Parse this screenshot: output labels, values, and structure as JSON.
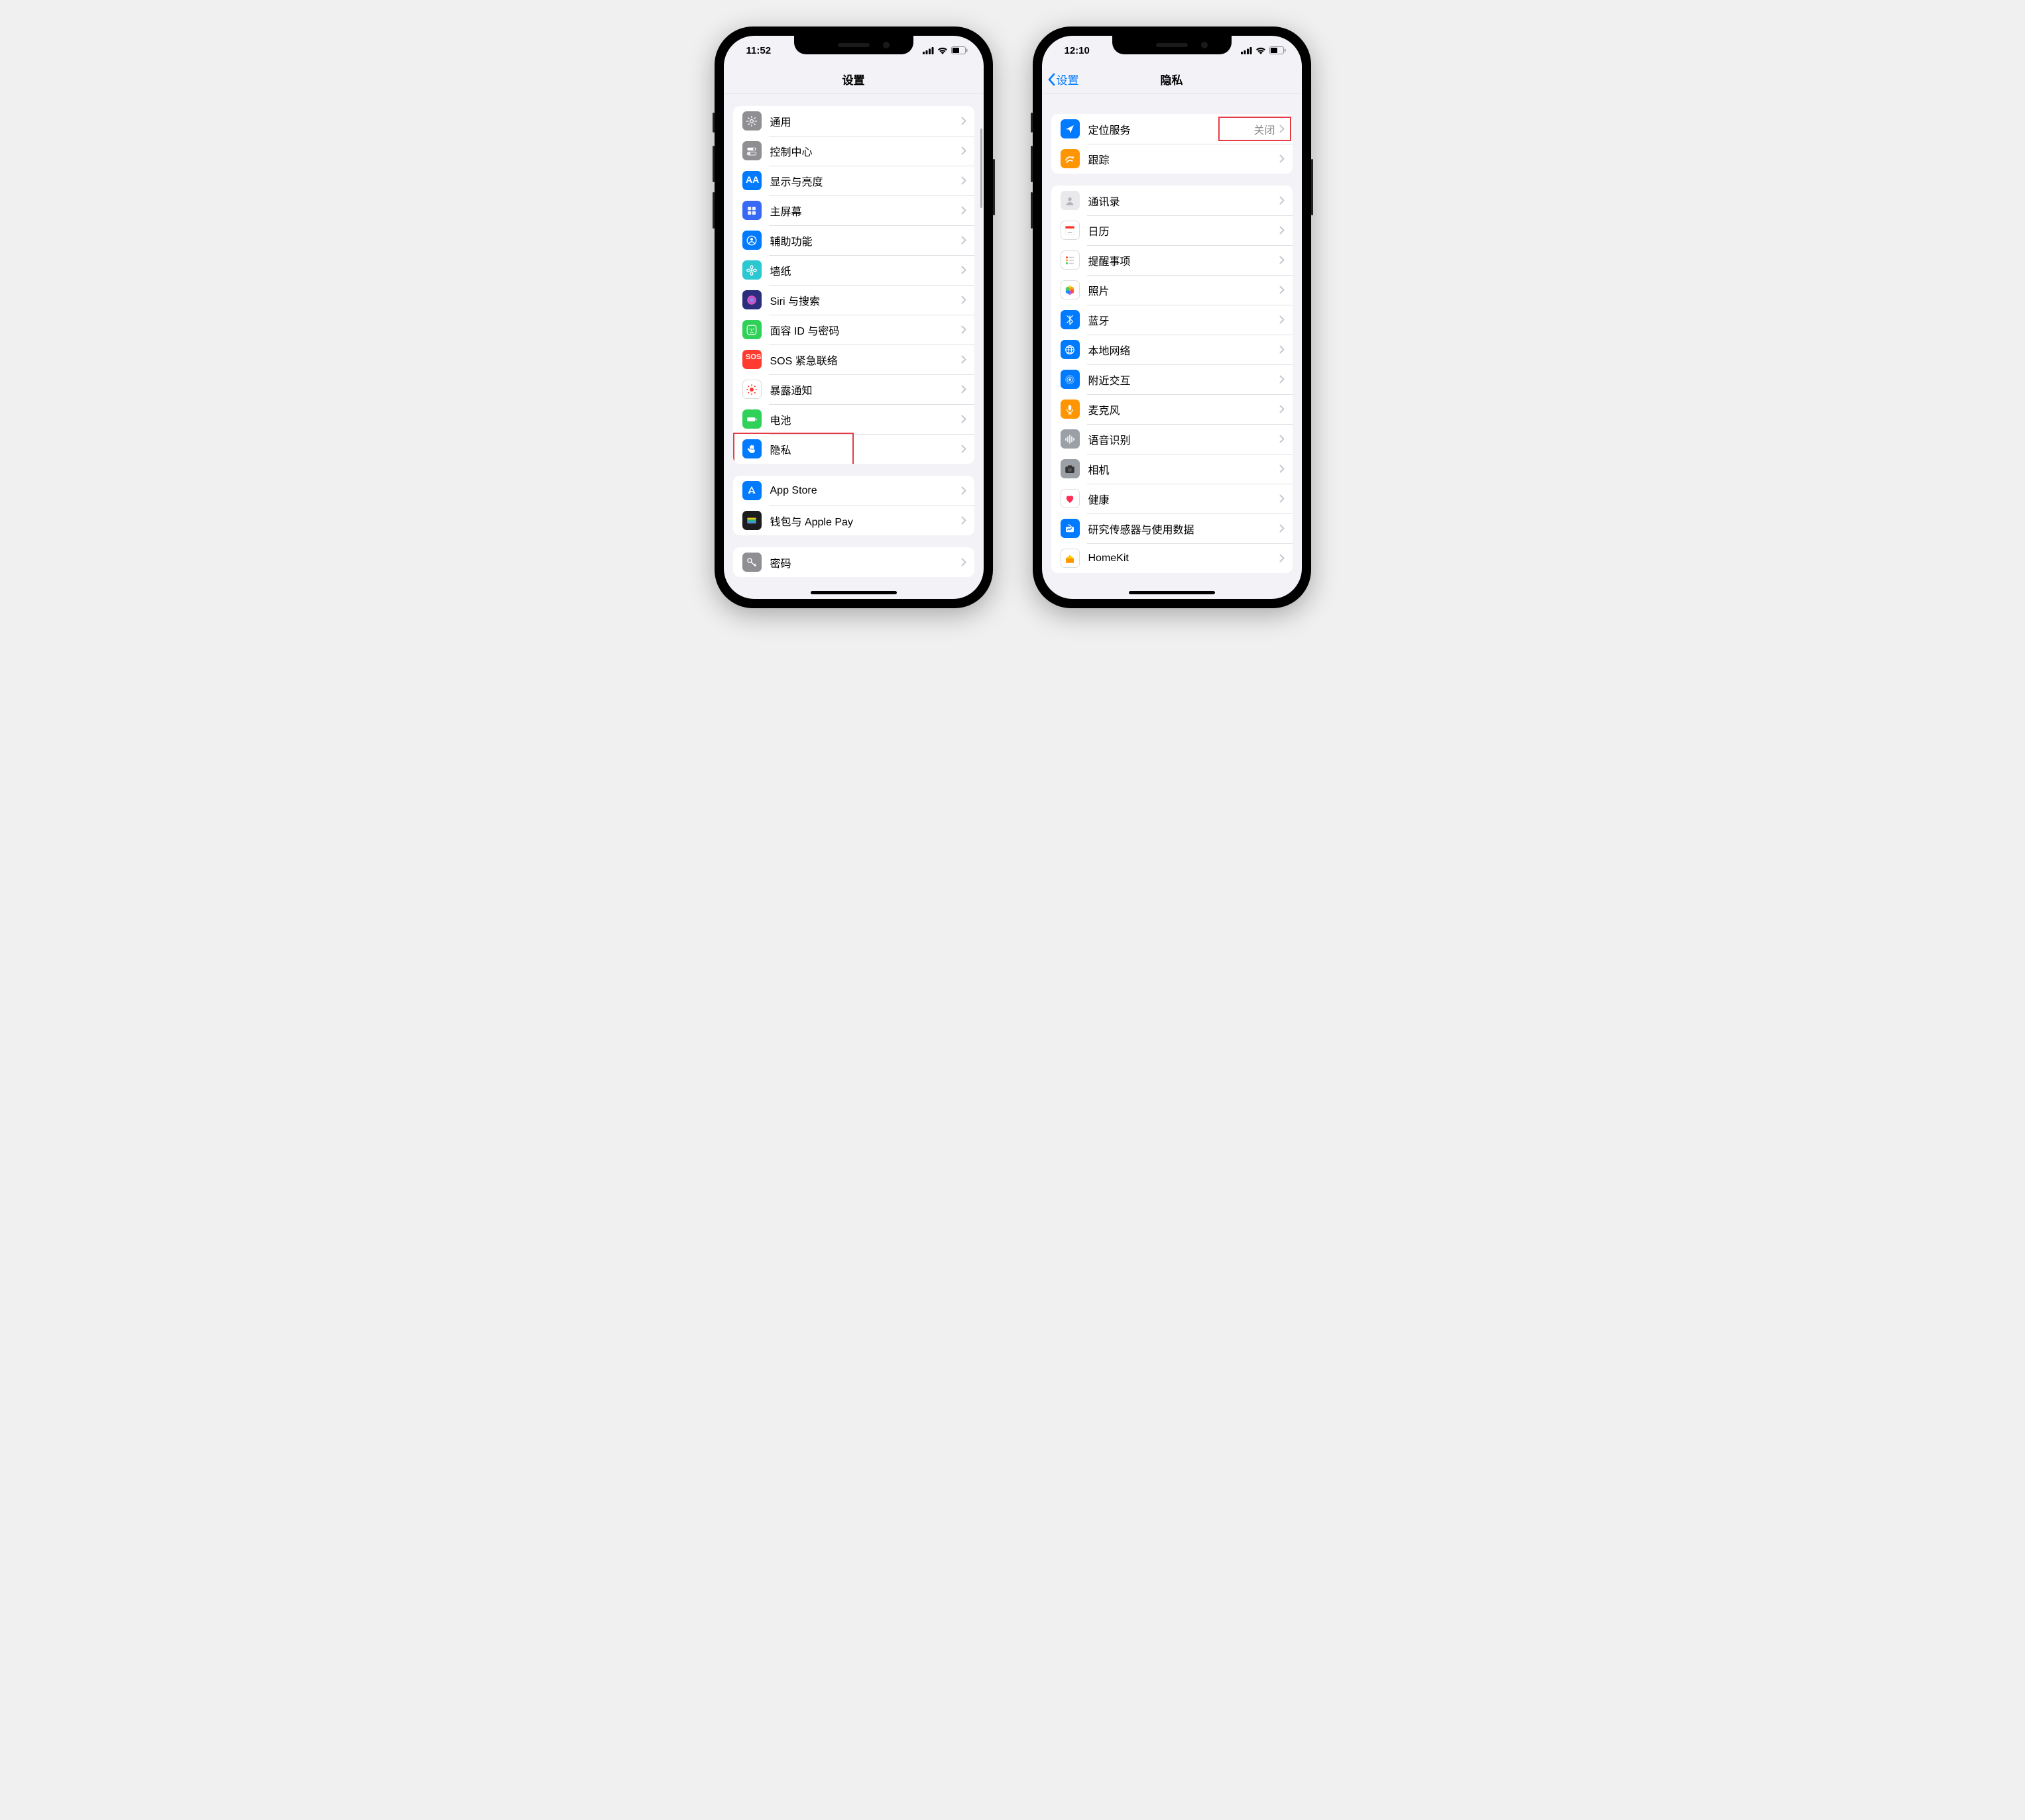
{
  "phones": {
    "left": {
      "statusbar": {
        "time": "11:52"
      },
      "navbar": {
        "title": "设置"
      },
      "groups": [
        {
          "rows": [
            {
              "id": "general",
              "label": "通用",
              "icon_bg": "bg-gray",
              "icon": "gear"
            },
            {
              "id": "control-center",
              "label": "控制中心",
              "icon_bg": "bg-gray",
              "icon": "toggles"
            },
            {
              "id": "display",
              "label": "显示与亮度",
              "icon_bg": "bg-blue",
              "icon": "aa"
            },
            {
              "id": "home-screen",
              "label": "主屏幕",
              "icon_bg": "bg-indigo",
              "icon": "grid"
            },
            {
              "id": "accessibility",
              "label": "辅助功能",
              "icon_bg": "bg-blue",
              "icon": "person"
            },
            {
              "id": "wallpaper",
              "label": "墙纸",
              "icon_bg": "bg-cyan",
              "icon": "flower"
            },
            {
              "id": "siri",
              "label": "Siri 与搜索",
              "icon_bg": "bg-darkblue",
              "icon": "siri"
            },
            {
              "id": "faceid",
              "label": "面容 ID 与密码",
              "icon_bg": "bg-green",
              "icon": "faceid"
            },
            {
              "id": "sos",
              "label": "SOS 紧急联络",
              "icon_bg": "bg-red",
              "icon": "sos"
            },
            {
              "id": "exposure",
              "label": "暴露通知",
              "icon_bg": "bg-white",
              "icon": "exposure"
            },
            {
              "id": "battery",
              "label": "电池",
              "icon_bg": "bg-green",
              "icon": "battery"
            },
            {
              "id": "privacy",
              "label": "隐私",
              "icon_bg": "bg-blue",
              "icon": "hand",
              "annotated": true
            }
          ]
        },
        {
          "rows": [
            {
              "id": "appstore",
              "label": "App Store",
              "icon_bg": "bg-blue",
              "icon": "appstore"
            },
            {
              "id": "wallet",
              "label": "钱包与 Apple Pay",
              "icon_bg": "bg-black",
              "icon": "wallet"
            }
          ]
        },
        {
          "rows": [
            {
              "id": "passwords",
              "label": "密码",
              "icon_bg": "bg-gray",
              "icon": "key"
            }
          ]
        }
      ]
    },
    "right": {
      "statusbar": {
        "time": "12:10"
      },
      "navbar": {
        "title": "隐私",
        "back": "设置"
      },
      "groups": [
        {
          "rows": [
            {
              "id": "location",
              "label": "定位服务",
              "detail": "关闭",
              "icon_bg": "bg-blue",
              "icon": "location",
              "annot_detail": true
            },
            {
              "id": "tracking",
              "label": "跟踪",
              "icon_bg": "bg-orange",
              "icon": "tracking"
            }
          ]
        },
        {
          "rows": [
            {
              "id": "contacts",
              "label": "通讯录",
              "icon_bg": "bg-lightgray",
              "icon": "contacts"
            },
            {
              "id": "calendar",
              "label": "日历",
              "icon_bg": "bg-white",
              "icon": "calendar"
            },
            {
              "id": "reminders",
              "label": "提醒事项",
              "icon_bg": "bg-white",
              "icon": "reminders"
            },
            {
              "id": "photos",
              "label": "照片",
              "icon_bg": "bg-white",
              "icon": "photos"
            },
            {
              "id": "bluetooth",
              "label": "蓝牙",
              "icon_bg": "bg-blue",
              "icon": "bluetooth"
            },
            {
              "id": "localnet",
              "label": "本地网络",
              "icon_bg": "bg-blue",
              "icon": "globe"
            },
            {
              "id": "nearby",
              "label": "附近交互",
              "icon_bg": "bg-blue",
              "icon": "nearby"
            },
            {
              "id": "microphone",
              "label": "麦克风",
              "icon_bg": "bg-orange",
              "icon": "mic"
            },
            {
              "id": "speech",
              "label": "语音识别",
              "icon_bg": "bg-bright-gray",
              "icon": "waveform"
            },
            {
              "id": "camera",
              "label": "相机",
              "icon_bg": "bg-bright-gray",
              "icon": "camera"
            },
            {
              "id": "health",
              "label": "健康",
              "icon_bg": "bg-white",
              "icon": "health"
            },
            {
              "id": "research",
              "label": "研究传感器与使用数据",
              "icon_bg": "bg-blue",
              "icon": "research"
            },
            {
              "id": "homekit",
              "label": "HomeKit",
              "icon_bg": "bg-white",
              "icon": "homekit"
            }
          ]
        }
      ]
    }
  }
}
